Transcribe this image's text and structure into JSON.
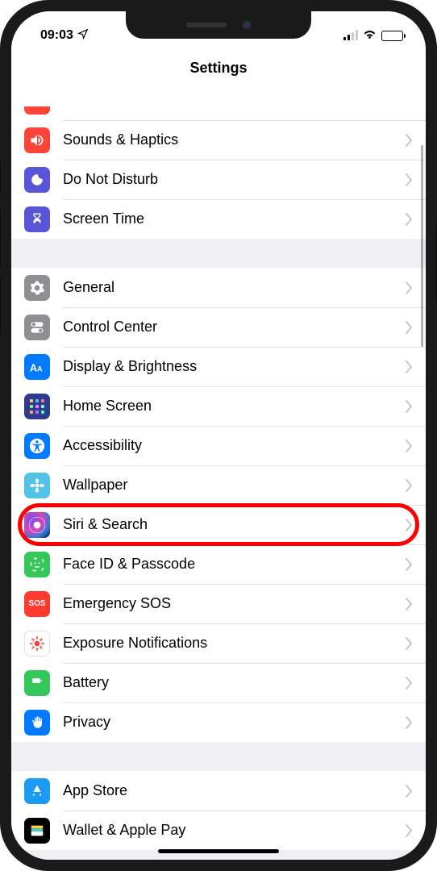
{
  "status_bar": {
    "time": "09:03"
  },
  "header": {
    "title": "Settings"
  },
  "groups": [
    {
      "items": [
        {
          "id": "truncated",
          "label": "",
          "icon": "volume-icon",
          "cls": "ic-orange"
        },
        {
          "id": "sounds-haptics",
          "label": "Sounds & Haptics",
          "icon": "speaker-icon",
          "cls": "ic-red1"
        },
        {
          "id": "do-not-disturb",
          "label": "Do Not Disturb",
          "icon": "moon-icon",
          "cls": "ic-purple"
        },
        {
          "id": "screen-time",
          "label": "Screen Time",
          "icon": "hourglass-icon",
          "cls": "ic-hourglass"
        }
      ]
    },
    {
      "items": [
        {
          "id": "general",
          "label": "General",
          "icon": "gear-icon",
          "cls": "ic-gray"
        },
        {
          "id": "control-center",
          "label": "Control Center",
          "icon": "switches-icon",
          "cls": "ic-gray2"
        },
        {
          "id": "display-brightness",
          "label": "Display & Brightness",
          "icon": "text-size-icon",
          "cls": "ic-blue"
        },
        {
          "id": "home-screen",
          "label": "Home Screen",
          "icon": "grid-icon",
          "cls": "ic-darkblue"
        },
        {
          "id": "accessibility",
          "label": "Accessibility",
          "icon": "accessibility-icon",
          "cls": "ic-blue2"
        },
        {
          "id": "wallpaper",
          "label": "Wallpaper",
          "icon": "flower-icon",
          "cls": "ic-teal"
        },
        {
          "id": "siri-search",
          "label": "Siri & Search",
          "icon": "siri-icon",
          "cls": "ic-siri",
          "highlighted": true
        },
        {
          "id": "face-id-passcode",
          "label": "Face ID & Passcode",
          "icon": "face-icon",
          "cls": "ic-green"
        },
        {
          "id": "emergency-sos",
          "label": "Emergency SOS",
          "icon": "sos-icon",
          "cls": "ic-sos",
          "icon_text": "SOS"
        },
        {
          "id": "exposure-notifications",
          "label": "Exposure Notifications",
          "icon": "virus-icon",
          "cls": "ic-white"
        },
        {
          "id": "battery",
          "label": "Battery",
          "icon": "battery-icon",
          "cls": "ic-battery"
        },
        {
          "id": "privacy",
          "label": "Privacy",
          "icon": "hand-icon",
          "cls": "ic-hand"
        }
      ]
    },
    {
      "items": [
        {
          "id": "app-store",
          "label": "App Store",
          "icon": "appstore-icon",
          "cls": "ic-appstore"
        },
        {
          "id": "wallet-apple-pay",
          "label": "Wallet & Apple Pay",
          "icon": "wallet-icon",
          "cls": "ic-black"
        }
      ]
    }
  ]
}
